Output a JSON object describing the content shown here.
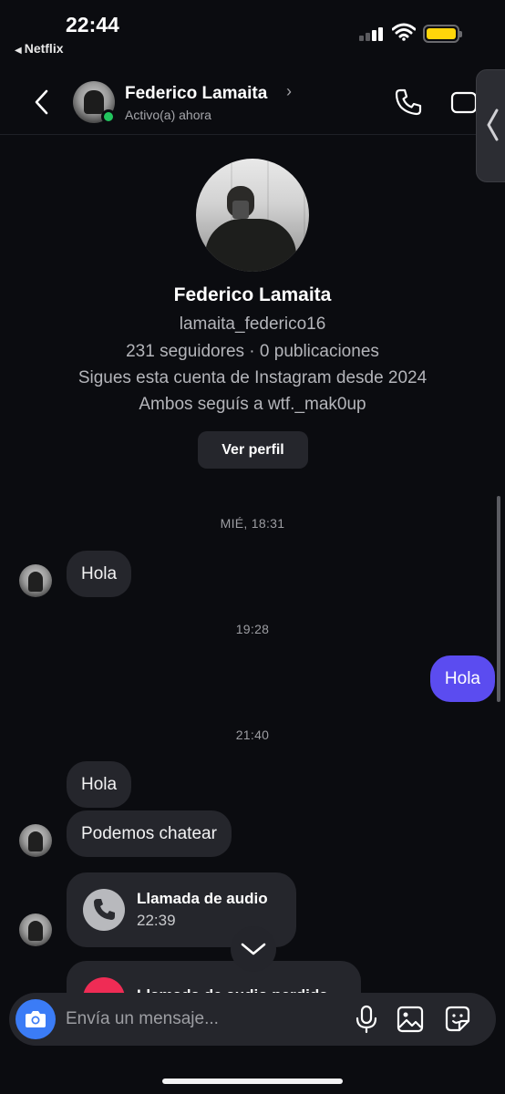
{
  "status_bar": {
    "time": "22:44",
    "back_app": "Netflix",
    "battery_color": "#ffd60a"
  },
  "header": {
    "name": "Federico Lamaita",
    "status": "Activo(a) ahora",
    "chevron": "›",
    "icons": [
      "back-chevron-icon",
      "phone-icon",
      "video-camera-icon"
    ]
  },
  "profile": {
    "name": "Federico Lamaita",
    "username": "lamaita_federico16",
    "stats": "231 seguidores · 0 publicaciones",
    "following_since": "Sigues esta cuenta de Instagram desde 2024",
    "mutual": "Ambos seguís a wtf._mak0up",
    "view_button": "Ver perfil"
  },
  "messages": {
    "ts1": "MIÉ, 18:31",
    "m1": "Hola",
    "ts2": "19:28",
    "m2_out": "Hola",
    "ts3": "21:40",
    "m3": "Hola",
    "m4": "Podemos chatear",
    "call": {
      "title": "Llamada de audio",
      "time": "22:39"
    },
    "missed_partial": "Llamada de audio perdida"
  },
  "composer": {
    "placeholder": "Envía un mensaje..."
  },
  "colors": {
    "background": "#0b0c10",
    "bubble_in": "#25262c",
    "bubble_out": "#5b4cf0",
    "accent_blue": "#3b7cf6",
    "online": "#22c55e"
  }
}
